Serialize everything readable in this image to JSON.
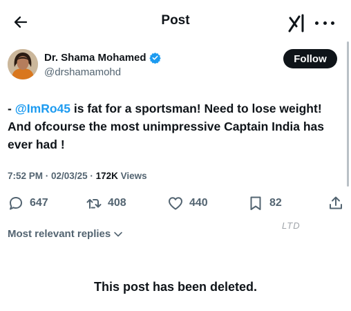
{
  "header": {
    "title": "Post"
  },
  "author": {
    "name": "Dr. Shama Mohamed",
    "handle": "@drshamamohd"
  },
  "follow_label": "Follow",
  "tweet": {
    "prefix": "- ",
    "mention": "@ImRo45",
    "body": " is fat for a sportsman! Need to lose weight! And ofcourse the most unimpressive Captain India has ever had  !"
  },
  "meta": {
    "time": "7:52 PM",
    "date": "02/03/25",
    "views_count": "172K",
    "views_label": "Views",
    "separator": " · "
  },
  "actions": {
    "replies": "647",
    "reposts": "408",
    "likes": "440",
    "bookmarks": "82"
  },
  "replies_sort": "Most relevant replies",
  "watermark": "LTD",
  "deleted_message": "This post has been deleted.",
  "icons": [
    "back-arrow-icon",
    "grok-icon",
    "more-icon",
    "verified-badge-icon",
    "reply-icon",
    "repost-icon",
    "like-icon",
    "bookmark-icon",
    "share-icon",
    "chevron-down-icon"
  ],
  "colors": {
    "accent": "#1d9bf0",
    "text": "#0f1419",
    "muted": "#536471",
    "button": "#0f1419"
  }
}
